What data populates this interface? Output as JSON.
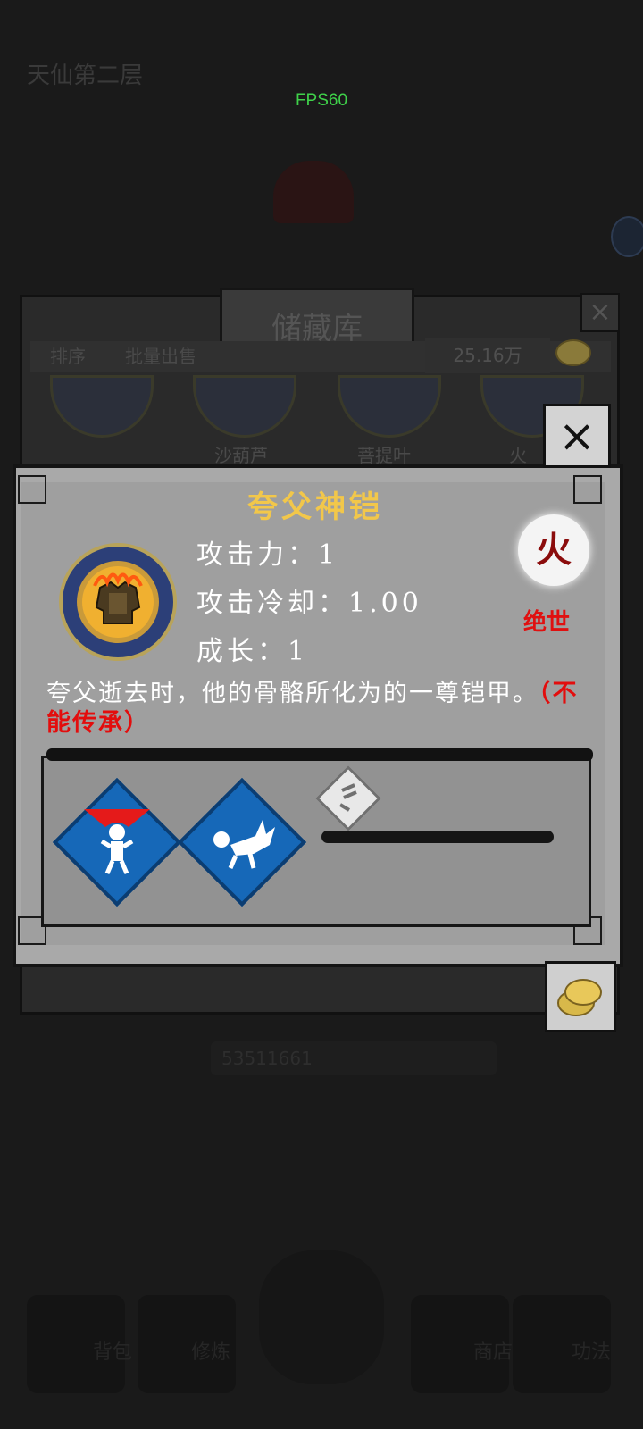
{
  "fps_label": "FPS60",
  "top_left": {
    "line1": "",
    "line2": "天仙第二层"
  },
  "storage": {
    "title": "储藏库",
    "close_symbol": "×",
    "tabs": [
      "排序",
      "批量出售"
    ],
    "coins": "25.16万",
    "items": [
      "",
      "沙葫芦",
      "菩提叶",
      "火"
    ],
    "gold_value": "53511661"
  },
  "detail": {
    "title": "夸父神铠",
    "close_symbol": "×",
    "stats": [
      "攻击力：1",
      "攻击冷却：1.00",
      "成长：1"
    ],
    "element": "火",
    "rarity": "绝世",
    "description": "夸父逝去时，他的骨骼所化为的一尊铠甲。",
    "description_note": "（不能传承）",
    "skills": [
      {
        "icon": "stab-damage-icon",
        "color": "#1668b8"
      },
      {
        "icon": "spiked-knockdown-icon",
        "color": "#1668b8"
      }
    ],
    "empty_skill_icon": "locked-skill-icon"
  },
  "bottom_nav": [
    "背包",
    "修炼",
    "商店",
    "功法"
  ]
}
